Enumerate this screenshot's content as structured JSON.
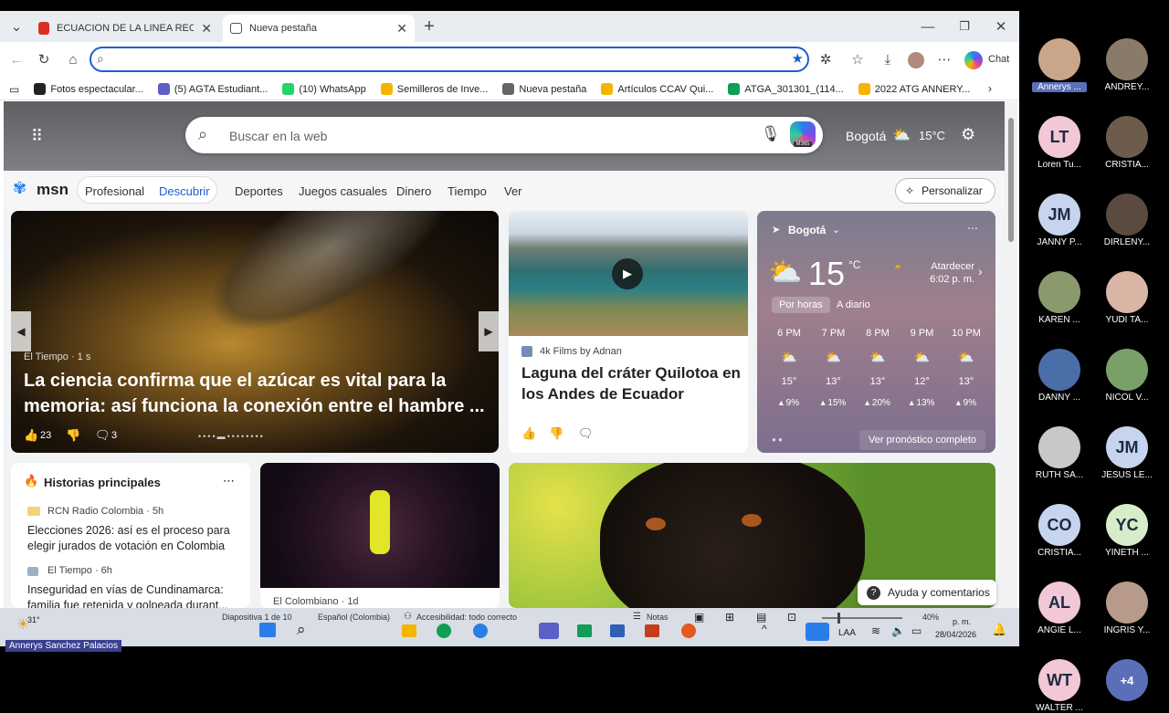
{
  "tabs": [
    {
      "label": "ECUACION DE LA LINEA RECTA tar",
      "icon": "pdf-icon"
    },
    {
      "label": "Nueva pestaña",
      "icon": "new-tab-icon"
    }
  ],
  "navbar": {
    "address_value": "",
    "chat_label": "Chat"
  },
  "bookmarks": [
    {
      "label": "Fotos espectacular...",
      "color": "#222222"
    },
    {
      "label": "(5) AGTA Estudiant...",
      "color": "#5b5fc7"
    },
    {
      "label": "(10) WhatsApp",
      "color": "#25d366"
    },
    {
      "label": "Semilleros de Inve...",
      "color": "#f4b400"
    },
    {
      "label": "Nueva pestaña",
      "color": "#666666"
    },
    {
      "label": "Artículos CCAV Qui...",
      "color": "#f4b400"
    },
    {
      "label": "ATGA_301301_(114...",
      "color": "#0f9d58"
    },
    {
      "label": "2022 ATG ANNERY...",
      "color": "#f4b400"
    }
  ],
  "search": {
    "placeholder": "Buscar en la web",
    "m365": "M365",
    "city": "Bogotá",
    "temp": "15°C"
  },
  "msn": {
    "logo": "msn",
    "nav": [
      "Profesional",
      "Descubrir",
      "Deportes",
      "Juegos casuales",
      "Dinero",
      "Tiempo",
      "Ver"
    ],
    "personalize": "Personalizar"
  },
  "lead": {
    "source": "El Tiempo · 1 s",
    "title": "La ciencia confirma que el azúcar es vital para la memoria: así funciona la conexión entre el hambre ...",
    "likes": "23",
    "comments": "3"
  },
  "video": {
    "source": "4k Films by Adnan",
    "title": "Laguna del cráter Quilotoa en los Andes de Ecuador"
  },
  "weather": {
    "city": "Bogotá",
    "temp": "15",
    "unit": "°C",
    "sunset": "Atardecer 6:02 p. m.",
    "tab_hourly": "Por horas",
    "tab_daily": "A diario",
    "hours": [
      {
        "time": "6 PM",
        "temp": "15°",
        "rain": "9%"
      },
      {
        "time": "7 PM",
        "temp": "13°",
        "rain": "15%"
      },
      {
        "time": "8 PM",
        "temp": "13°",
        "rain": "20%"
      },
      {
        "time": "9 PM",
        "temp": "12°",
        "rain": "13%"
      },
      {
        "time": "10 PM",
        "temp": "13°",
        "rain": "9%"
      }
    ],
    "forecast_link": "Ver pronóstico completo"
  },
  "top_stories": {
    "title": "Historias principales",
    "items": [
      {
        "source": "RCN Radio Colombia · 5h",
        "title": "Elecciones 2026: así es el proceso para elegir jurados de votación en Colombia"
      },
      {
        "source": "El Tiempo · 6h",
        "title": "Inseguridad en vías de Cundinamarca: familia fue retenida y golpeada durant..."
      }
    ]
  },
  "concert": {
    "source": "El Colombiano · 1d"
  },
  "feedback": "Ayuda y comentarios",
  "ppt_status": {
    "slide": "Diapositiva 1 de 10",
    "lang": "Español (Colombia)",
    "access": "Accesibilidad: todo correcto",
    "notes": "Notas",
    "zoom": "40%"
  },
  "taskbar": {
    "temp": "31°",
    "lang": "LAA",
    "time": "p. m.",
    "date": "28/04/2026"
  },
  "presenter": "Annerys Sanchez Palacios",
  "participants": [
    {
      "name": "Annerys ...",
      "initials": "",
      "color": "#c9a68a",
      "highlight": true
    },
    {
      "name": "ANDREY...",
      "initials": "",
      "color": "#8a7a6a"
    },
    {
      "name": "Loren Tu...",
      "initials": "LT",
      "color": "#f2c8d6"
    },
    {
      "name": "CRISTIA...",
      "initials": "",
      "color": "#6d5c4b"
    },
    {
      "name": "JANNY P...",
      "initials": "JM",
      "color": "#c7d4ef"
    },
    {
      "name": "DIRLENY...",
      "initials": "",
      "color": "#5a4a40"
    },
    {
      "name": "KAREN ...",
      "initials": "",
      "color": "#8b9a6c"
    },
    {
      "name": "YUDI TA...",
      "initials": "",
      "color": "#d9b5a5"
    },
    {
      "name": "DANNY ...",
      "initials": "",
      "color": "#4a6ea8"
    },
    {
      "name": "NICOL V...",
      "initials": "",
      "color": "#7aa06a"
    },
    {
      "name": "RUTH SA...",
      "initials": "",
      "color": "#c8c8c8"
    },
    {
      "name": "JESUS LE...",
      "initials": "JM",
      "color": "#c7d4ef"
    },
    {
      "name": "CRISTIA...",
      "initials": "CO",
      "color": "#c7d4ef"
    },
    {
      "name": "YINETH ...",
      "initials": "YC",
      "color": "#d7ecc8"
    },
    {
      "name": "ANGIE L...",
      "initials": "AL",
      "color": "#f2c8d6"
    },
    {
      "name": "INGRIS Y...",
      "initials": "",
      "color": "#b89a8a"
    },
    {
      "name": "WALTER ...",
      "initials": "WT",
      "color": "#f2c8d6"
    },
    {
      "name": "+4",
      "initials": "+4",
      "color": "#5b6fb8",
      "more": true
    }
  ]
}
